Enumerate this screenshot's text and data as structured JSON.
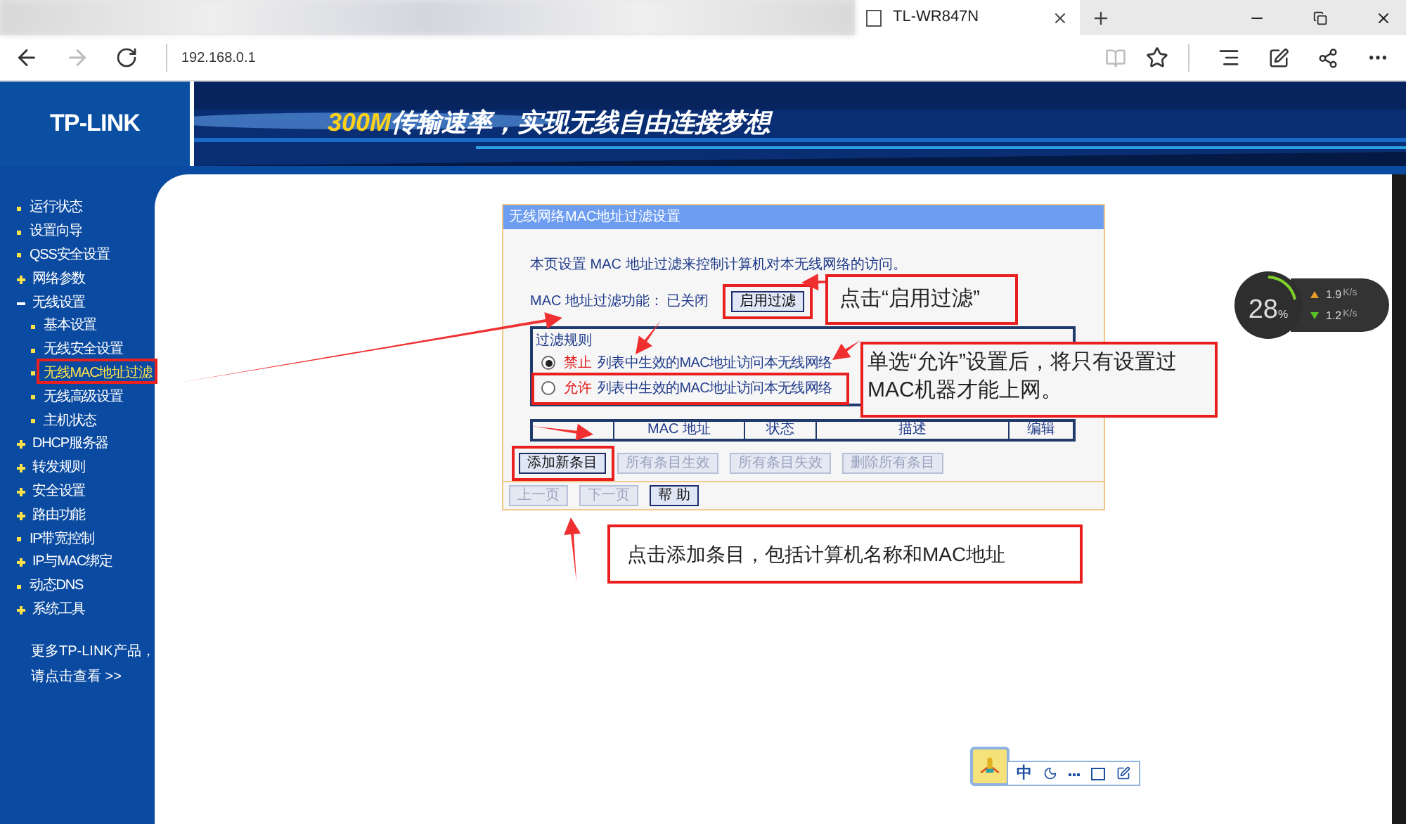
{
  "browser": {
    "active_tab": {
      "title": "TL-WR847N"
    },
    "address": "192.168.0.1"
  },
  "banner": {
    "logo": "TP-LINK",
    "slogan_highlight": "300M",
    "slogan_rest": "传输速率，实现无线自由连接梦想"
  },
  "sidebar": {
    "items": [
      {
        "label": "运行状态",
        "kind": "leaf",
        "selected": false
      },
      {
        "label": "设置向导",
        "kind": "leaf",
        "selected": false
      },
      {
        "label": "QSS安全设置",
        "kind": "leaf",
        "selected": false
      },
      {
        "label": "网络参数",
        "kind": "group",
        "expanded": false,
        "selected": false
      },
      {
        "label": "无线设置",
        "kind": "group",
        "expanded": true,
        "selected": false,
        "children": [
          {
            "label": "基本设置",
            "kind": "leaf",
            "selected": false
          },
          {
            "label": "无线安全设置",
            "kind": "leaf",
            "selected": false
          },
          {
            "label": "无线MAC地址过滤",
            "kind": "leaf",
            "selected": true
          },
          {
            "label": "无线高级设置",
            "kind": "leaf",
            "selected": false
          },
          {
            "label": "主机状态",
            "kind": "leaf",
            "selected": false
          }
        ]
      },
      {
        "label": "DHCP服务器",
        "kind": "group",
        "expanded": false,
        "selected": false
      },
      {
        "label": "转发规则",
        "kind": "group",
        "expanded": false,
        "selected": false
      },
      {
        "label": "安全设置",
        "kind": "group",
        "expanded": false,
        "selected": false
      },
      {
        "label": "路由功能",
        "kind": "group",
        "expanded": false,
        "selected": false
      },
      {
        "label": "IP带宽控制",
        "kind": "leaf",
        "selected": false
      },
      {
        "label": "IP与MAC绑定",
        "kind": "group",
        "expanded": false,
        "selected": false
      },
      {
        "label": "动态DNS",
        "kind": "leaf",
        "selected": false
      },
      {
        "label": "系统工具",
        "kind": "group",
        "expanded": false,
        "selected": false
      }
    ],
    "more_link": [
      "更多TP-LINK产品，",
      "请点击查看 >>"
    ]
  },
  "panel": {
    "title": "无线网络MAC地址过滤设置",
    "intro": "本页设置 MAC 地址过滤来控制计算机对本无线网络的访问。",
    "status_label": "MAC 地址过滤功能：",
    "status_value": "已关闭",
    "enable_button": "启用过滤",
    "rules": {
      "legend": "过滤规则",
      "options": [
        {
          "action": "禁止",
          "text": "列表中生效的MAC地址访问本无线网络",
          "selected": true
        },
        {
          "action": "允许",
          "text": "列表中生效的MAC地址访问本无线网络",
          "selected": false
        }
      ]
    },
    "table": {
      "columns": [
        "",
        "MAC 地址",
        "状态",
        "描述",
        "编辑"
      ]
    },
    "buttons": [
      {
        "label": "添加新条目",
        "disabled": false
      },
      {
        "label": "所有条目生效",
        "disabled": true
      },
      {
        "label": "所有条目失效",
        "disabled": true
      },
      {
        "label": "删除所有条目",
        "disabled": true
      }
    ],
    "nav_buttons": [
      {
        "label": "上一页",
        "disabled": true
      },
      {
        "label": "下一页",
        "disabled": true
      },
      {
        "label": "帮 助",
        "disabled": false
      }
    ]
  },
  "annotations": [
    {
      "text": "点击“启用过滤”"
    },
    {
      "text": "单选“允许”设置后，将只有设置过MAC机器才能上网。"
    },
    {
      "text": "点击添加条目，包括计算机名称和MAC地址"
    }
  ],
  "net_widget": {
    "percent": "28",
    "unit": "%",
    "up": "1.9",
    "up_unit": "K/s",
    "down": "1.2",
    "down_unit": "K/s"
  },
  "ime_bar": {
    "mode": "中"
  }
}
